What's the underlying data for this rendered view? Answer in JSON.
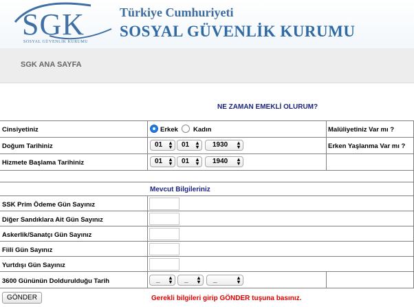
{
  "header": {
    "logo_text": "SGK",
    "logo_subtext": "SOSYAL GÜVENLİK KURUMU",
    "title_line1": "Türkiye Cumhuriyeti",
    "title_line2": "SOSYAL GÜVENLİK KURUMU"
  },
  "nav": {
    "home_label": "SGK ANA SAYFA"
  },
  "form": {
    "heading": "NE ZAMAN EMEKLİ OLURUM?",
    "gender_label": "Cinsiyetiniz",
    "gender_options": [
      {
        "label": "Erkek",
        "selected": true
      },
      {
        "label": "Kadın",
        "selected": false
      }
    ],
    "birth_label": "Doğum Tarihiniz",
    "birth_date": {
      "day": "01",
      "month": "01",
      "year": "1930"
    },
    "start_label": "Hizmete Başlama Tarihiniz",
    "start_date": {
      "day": "01",
      "month": "01",
      "year": "1940"
    },
    "disability_label": "Malüliyetiniz Var mı ?",
    "early_aging_label": "Erken Yaşlanma Var mı ?",
    "current_info_title": "Mevcut  Bilgileriniz",
    "fields": [
      {
        "label": "SSK Prim Ödeme Gün Sayınız",
        "value": ""
      },
      {
        "label": "Diğer Sandıklara Ait Gün Sayınız",
        "value": ""
      },
      {
        "label": "Askerlik/Sanatçı Gün Sayınız",
        "value": ""
      },
      {
        "label": "Fiili Gün Sayınız",
        "value": ""
      },
      {
        "label": "Yurtdışı Gün Sayınız",
        "value": ""
      }
    ],
    "completion_label": "3600 Gününün Doldurulduğu Tarih",
    "completion_date": {
      "day": "_",
      "month": "_",
      "year": "_"
    },
    "submit_label": "GÖNDER",
    "hint": "Gerekli bilgileri girip GÖNDER tuşuna basınız."
  },
  "colors": {
    "heading": "#1a237e",
    "hint": "#e00000",
    "radio_selected": "#1f7ae0"
  }
}
